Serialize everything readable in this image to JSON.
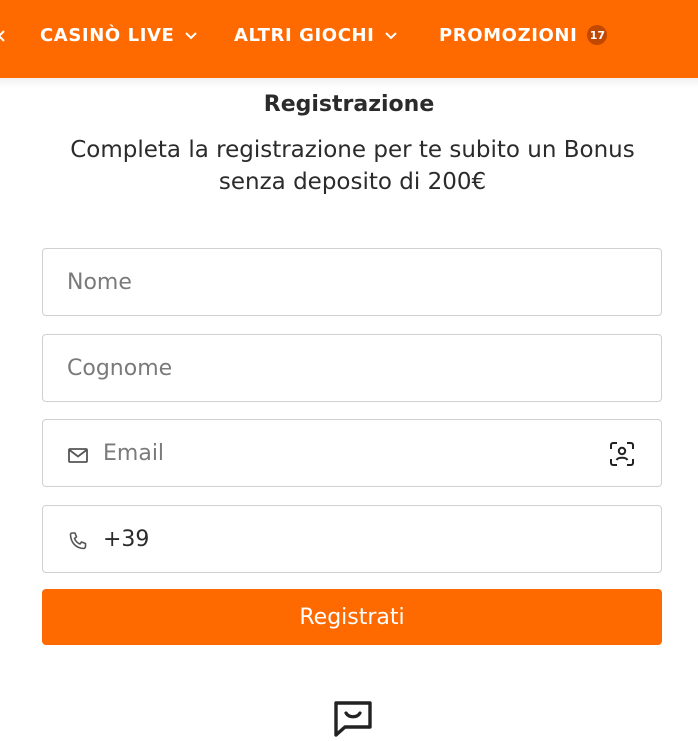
{
  "nav": {
    "items": [
      {
        "label": "CASINÒ LIVE",
        "has_chevron": true
      },
      {
        "label": "ALTRI GIOCHI",
        "has_chevron": true
      },
      {
        "label": "PROMOZIONI",
        "badge": "17"
      }
    ],
    "background": "#ff6a00"
  },
  "form": {
    "title": "Registrazione",
    "subtitle": "Completa la registrazione per te subito un Bonus senza deposito di 200€",
    "fields": {
      "nome": {
        "placeholder": "Nome",
        "value": ""
      },
      "cognome": {
        "placeholder": "Cognome",
        "value": ""
      },
      "email": {
        "placeholder": "Email",
        "value": "",
        "icon": "mail-icon",
        "trailing_icon": "face-id-icon"
      },
      "phone": {
        "placeholder": "",
        "value": "+39",
        "icon": "phone-icon"
      }
    },
    "submit_label": "Registrati",
    "accent": "#ff6a00"
  },
  "footer": {
    "icon": "chat-icon"
  }
}
